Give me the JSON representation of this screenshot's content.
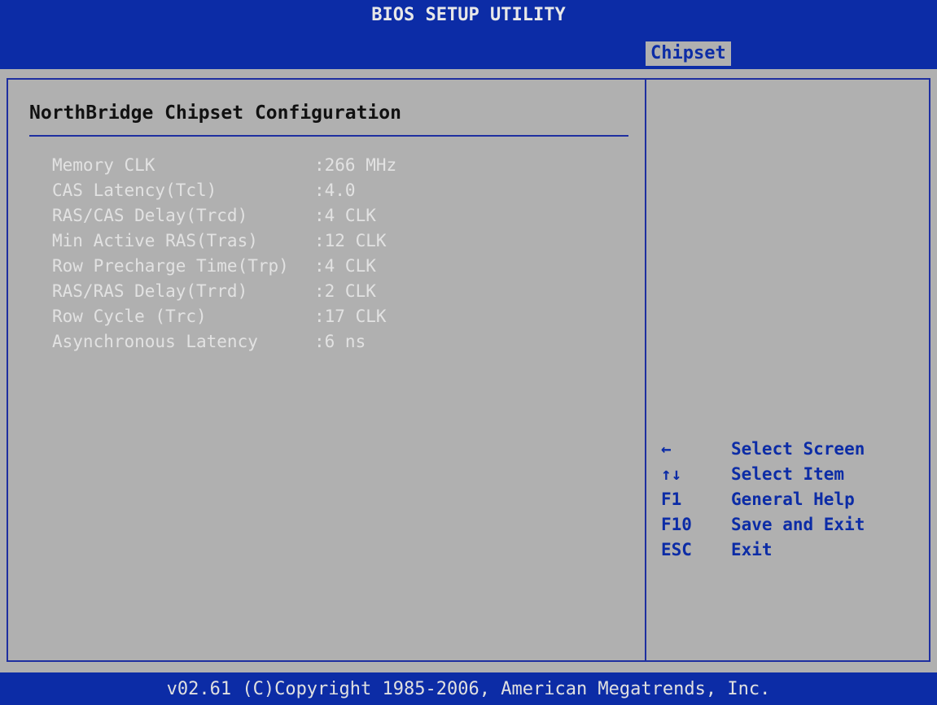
{
  "window": {
    "title": "BIOS SETUP UTILITY"
  },
  "tabs": {
    "active": "Chipset"
  },
  "panel": {
    "title": "NorthBridge Chipset Configuration",
    "items": [
      {
        "label": "Memory CLK",
        "value": ":266 MHz"
      },
      {
        "label": "CAS Latency(Tcl)",
        "value": ":4.0"
      },
      {
        "label": "RAS/CAS Delay(Trcd)",
        "value": ":4 CLK"
      },
      {
        "label": "Min Active RAS(Tras)",
        "value": ":12 CLK"
      },
      {
        "label": "Row Precharge Time(Trp)",
        "value": ":4 CLK"
      },
      {
        "label": "RAS/RAS Delay(Trrd)",
        "value": ":2 CLK"
      },
      {
        "label": "Row Cycle (Trc)",
        "value": ":17 CLK"
      },
      {
        "label": "Asynchronous Latency",
        "value": ":6 ns"
      }
    ]
  },
  "help": {
    "keys": [
      {
        "key": "←",
        "action": "Select Screen"
      },
      {
        "key": "↑↓",
        "action": "Select Item"
      },
      {
        "key": "F1",
        "action": "General Help"
      },
      {
        "key": "F10",
        "action": "Save and Exit"
      },
      {
        "key": "ESC",
        "action": "Exit"
      }
    ]
  },
  "footer": {
    "copyright": "v02.61 (C)Copyright 1985-2006, American Megatrends, Inc."
  },
  "colors": {
    "bar_blue": "#0c2ca6",
    "panel_gray": "#b0b0b0",
    "border_blue": "#1e2fa0",
    "info_text": "#e2e2e2"
  }
}
